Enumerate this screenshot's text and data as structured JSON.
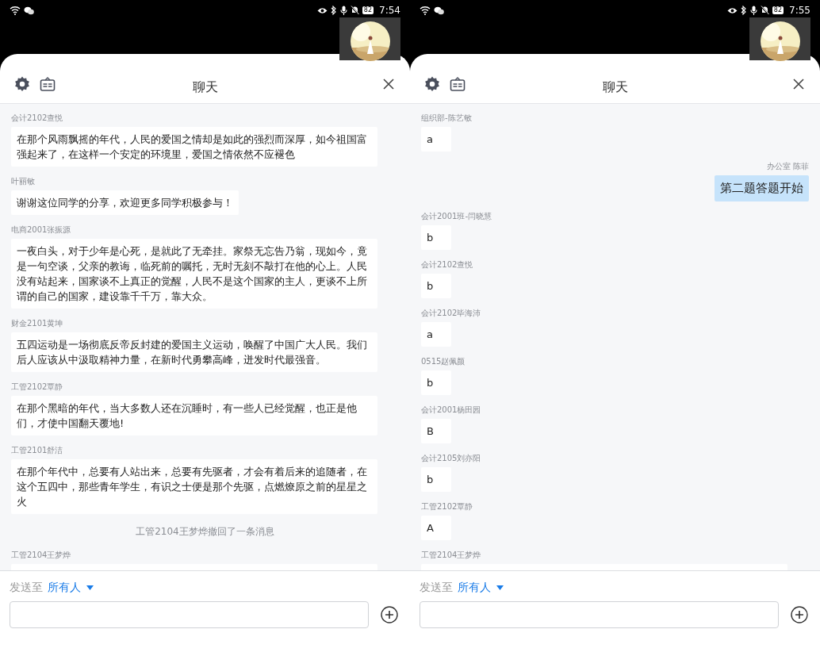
{
  "screens": [
    {
      "status_bar": {
        "battery": "82",
        "time": "7:54"
      },
      "title": "聊天",
      "messages": [
        {
          "kind": "incoming",
          "sender": "会计2102查悦",
          "text": "在那个风雨飘摇的年代，人民的爱国之情却是如此的强烈而深厚，如今祖国富强起来了，在这样一个安定的环境里，爱国之情依然不应褪色"
        },
        {
          "kind": "incoming",
          "sender": "叶丽敏",
          "text": "谢谢这位同学的分享，欢迎更多同学积极参与！"
        },
        {
          "kind": "incoming",
          "sender": "电商2001张振源",
          "text": "一夜白头，对于少年是心死，是就此了无牵挂。家祭无忘告乃翁，现如今，竟是一句空谈，父亲的教诲，临死前的嘱托，无时无刻不敲打在他的心上。人民没有站起来，国家谈不上真正的觉醒，人民不是这个国家的主人，更谈不上所谓的自己的国家，建设靠千千万，靠大众。"
        },
        {
          "kind": "incoming",
          "sender": "财金2101黄坤",
          "text": "五四运动是一场彻底反帝反封建的爱国主义运动，唤醒了中国广大人民。我们后人应该从中汲取精神力量，在新时代勇攀高峰，迸发时代最强音。"
        },
        {
          "kind": "incoming",
          "sender": "工管2102覃静",
          "text": "在那个黑暗的年代，当大多数人还在沉睡时，有一些人已经觉醒，也正是他们，才使中国翻天覆地!"
        },
        {
          "kind": "incoming",
          "sender": "工管2101舒洁",
          "text": "在那个年代中，总要有人站出来，总要有先驱者，才会有着后来的追随者，在这个五四中，那些青年学生，有识之士便是那个先驱，点燃燎原之前的星星之火"
        },
        {
          "kind": "notice",
          "text": "工管2104王梦烨撤回了一条消息"
        },
        {
          "kind": "clipped",
          "sender": "工管2104王梦烨"
        }
      ],
      "send_to": {
        "label": "发送至",
        "recipient": "所有人"
      }
    },
    {
      "status_bar": {
        "battery": "82",
        "time": "7:55"
      },
      "title": "聊天",
      "messages": [
        {
          "kind": "incoming",
          "sender": "组织部-陈艺敏",
          "text": "a"
        },
        {
          "kind": "outgoing",
          "sender": "办公室 陈菲",
          "text": "第二题答题开始"
        },
        {
          "kind": "incoming",
          "sender": "会计2001班-闫晓慧",
          "text": "b"
        },
        {
          "kind": "incoming",
          "sender": "会计2102查悦",
          "text": "b"
        },
        {
          "kind": "incoming",
          "sender": "会计2102毕海沛",
          "text": "a"
        },
        {
          "kind": "incoming",
          "sender": "0515赵佩颜",
          "text": "b"
        },
        {
          "kind": "incoming",
          "sender": "会计2001杨田园",
          "text": "B"
        },
        {
          "kind": "incoming",
          "sender": "会计2105刘亦阳",
          "text": "b"
        },
        {
          "kind": "incoming",
          "sender": "工管2102覃静",
          "text": "A"
        },
        {
          "kind": "clipped",
          "sender": "工管2104王梦烨"
        }
      ],
      "send_to": {
        "label": "发送至",
        "recipient": "所有人"
      }
    }
  ]
}
